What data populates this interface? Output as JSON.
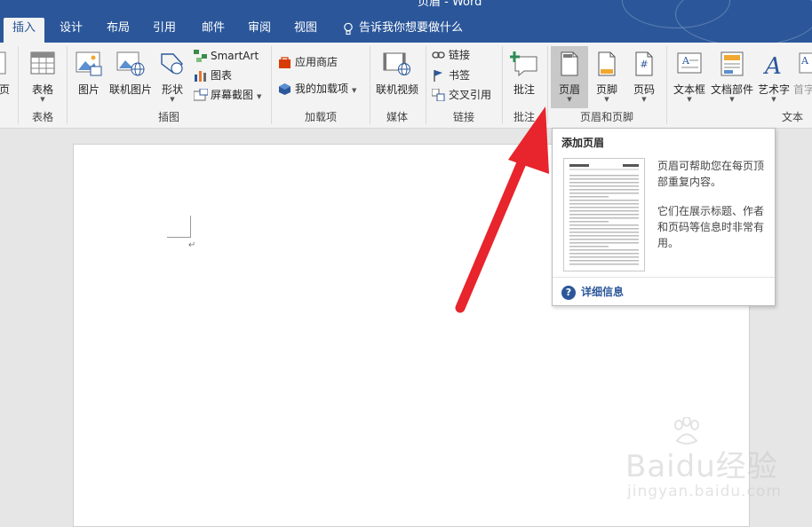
{
  "window": {
    "title_fragment": "页眉 - Word"
  },
  "tabs": [
    {
      "label": "插入",
      "active": true
    },
    {
      "label": "设计"
    },
    {
      "label": "布局"
    },
    {
      "label": "引用"
    },
    {
      "label": "邮件"
    },
    {
      "label": "审阅"
    },
    {
      "label": "视图"
    }
  ],
  "tell_me": {
    "text": "告诉我你想要做什么",
    "icon": "lightbulb-icon"
  },
  "ribbon": {
    "pages": {
      "label": "页"
    },
    "tables": {
      "btn_table": "表格",
      "group": "表格"
    },
    "illustrations": {
      "btn_picture": "图片",
      "btn_online_picture": "联机图片",
      "btn_shapes": "形状",
      "btn_smartart": "SmartArt",
      "btn_chart": "图表",
      "btn_screenshot": "屏幕截图",
      "group": "插图"
    },
    "addins": {
      "btn_store": "应用商店",
      "btn_my_addins": "我的加载项",
      "group": "加载项"
    },
    "media": {
      "btn_online_video": "联机视频",
      "group": "媒体"
    },
    "links": {
      "btn_link": "链接",
      "btn_bookmark": "书签",
      "btn_crossref": "交叉引用",
      "group": "链接"
    },
    "comments": {
      "btn_comment": "批注",
      "group": "批注"
    },
    "header_footer": {
      "btn_header": "页眉",
      "btn_footer": "页脚",
      "btn_page_number": "页码",
      "group": "页眉和页脚"
    },
    "text": {
      "btn_textbox": "文本框",
      "btn_quickparts": "文档部件",
      "btn_wordart": "艺术字",
      "btn_dropcap": "首字",
      "group": "文本"
    }
  },
  "tooltip": {
    "title": "添加页眉",
    "desc1": "页眉可帮助您在每页顶部重复内容。",
    "desc2": "它们在展示标题、作者和页码等信息时非常有用。",
    "help": "详细信息"
  },
  "document": {
    "paragraph_mark": "↵"
  },
  "watermark": {
    "text": "Baidu经验",
    "url": "jingyan.baidu.com"
  },
  "colors": {
    "accent": "#2b579a",
    "ribbon_bg": "#f3f3f3",
    "arrow": "#e8242c"
  }
}
